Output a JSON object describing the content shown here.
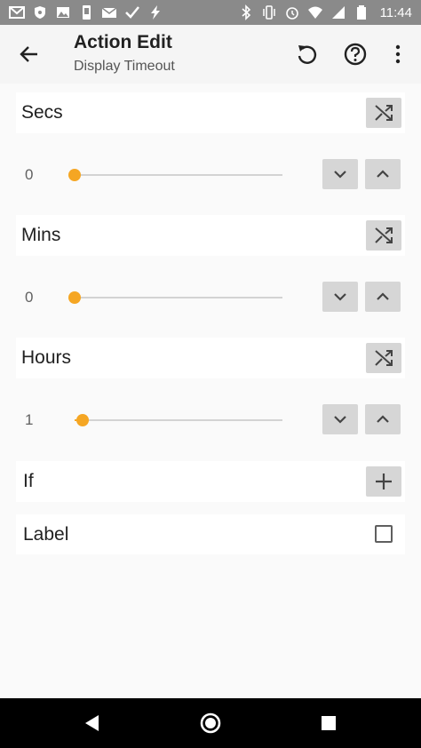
{
  "status_bar": {
    "time": "11:44",
    "left_icons": [
      "gmail-icon",
      "shield-icon",
      "image-icon",
      "phone-icon",
      "mail-icon",
      "tasker-icon",
      "bolt-icon"
    ],
    "right_icons": [
      "bluetooth-icon",
      "vibrate-icon",
      "alarm-icon",
      "wifi-icon",
      "signal-icon",
      "battery-icon"
    ]
  },
  "toolbar": {
    "title": "Action Edit",
    "subtitle": "Display Timeout"
  },
  "sections": [
    {
      "label": "Secs",
      "value": "0",
      "slider_fraction": 0.0
    },
    {
      "label": "Mins",
      "value": "0",
      "slider_fraction": 0.0
    },
    {
      "label": "Hours",
      "value": "1",
      "slider_fraction": 0.04
    }
  ],
  "if_row": {
    "label": "If"
  },
  "label_row": {
    "label": "Label",
    "checked": false
  },
  "colors": {
    "accent": "#f5a623",
    "button_bg": "#d6d6d6",
    "status_bar": "#8a8a8a",
    "nav_bar": "#000000"
  }
}
